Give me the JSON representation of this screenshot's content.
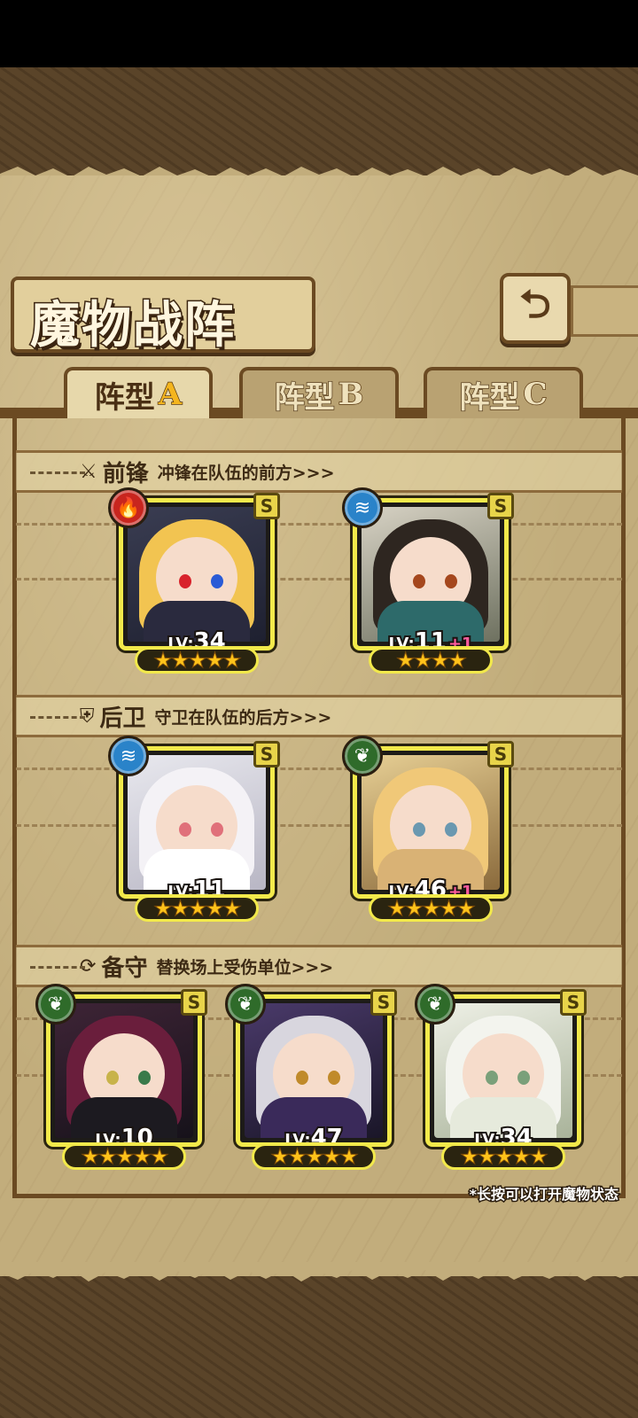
{
  "title": "魔物战阵",
  "back_icon": "return-arrow",
  "tabs": [
    {
      "label": "阵型",
      "letter": "A",
      "active": true
    },
    {
      "label": "阵型",
      "letter": "B",
      "active": false
    },
    {
      "label": "阵型",
      "letter": "C",
      "active": false
    }
  ],
  "sections": {
    "vanguard": {
      "icon": "sword-icon",
      "name": "前锋",
      "desc": "冲锋在队伍的前方>>>"
    },
    "rearguard": {
      "icon": "shield-icon",
      "name": "后卫",
      "desc": "守卫在队伍的后方>>>"
    },
    "reserve": {
      "icon": "swap-icon",
      "name": "备守",
      "desc": "替换场上受伤单位>>>"
    }
  },
  "lv_prefix": "LV:",
  "units": {
    "vanguard": [
      {
        "element": "fire",
        "rank": "S",
        "level": "34",
        "bonus": "",
        "stars": "★★★★★"
      },
      {
        "element": "water",
        "rank": "S",
        "level": "11",
        "bonus": "+1",
        "stars": "★★★★"
      }
    ],
    "rearguard": [
      {
        "element": "water",
        "rank": "S",
        "level": "11",
        "bonus": "",
        "stars": "★★★★★"
      },
      {
        "element": "wood",
        "rank": "S",
        "level": "46",
        "bonus": "+1",
        "stars": "★★★★★"
      }
    ],
    "reserve": [
      {
        "element": "wood",
        "rank": "S",
        "level": "10",
        "bonus": "",
        "stars": "★★★★★"
      },
      {
        "element": "wood",
        "rank": "S",
        "level": "47",
        "bonus": "",
        "stars": "★★★★★"
      },
      {
        "element": "wood",
        "rank": "S",
        "level": "34",
        "bonus": "",
        "stars": "★★★★★"
      }
    ]
  },
  "hint": "*长按可以打开魔物状态",
  "colors": {
    "frame": "#f2e94b",
    "fire": "#c8251e",
    "water": "#2a83c9",
    "wood": "#2f6b2a"
  }
}
